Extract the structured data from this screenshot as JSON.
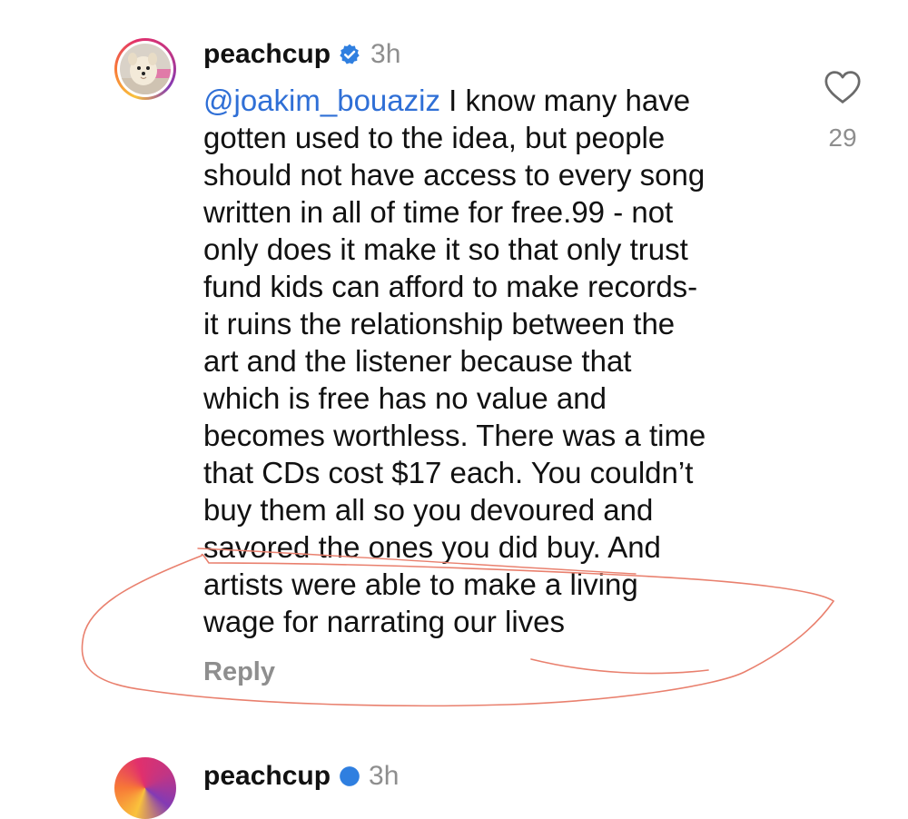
{
  "comment": {
    "username": "peachcup",
    "verified_icon": "verified-badge-icon",
    "time": "3h",
    "mention": "@joakim_bouaziz",
    "lines": [
      " I know many have",
      "gotten used to the idea, but people",
      "should not have access to every song",
      "written in all of time for free.99 - not",
      "only does it make it so that only trust",
      "fund kids can afford to make records-",
      "it ruins the relationship between the",
      "art and the listener because that",
      "which is free has no value and",
      "becomes worthless. There was a time",
      "that CDs cost $17 each. You couldn’t",
      "buy them all so you devoured and",
      "savored the ones you did buy. And",
      "artists were able to make a living",
      "wage for narrating our lives"
    ],
    "reply_label": "Reply",
    "like_count": "29",
    "like_icon": "heart-outline-icon"
  },
  "next_comment": {
    "username": "peachcup",
    "time": "3h"
  },
  "colors": {
    "mention": "#2f6fd6",
    "verified": "#2f7fe0",
    "annotation_stroke": "#e9806e",
    "secondary_text": "#8e8e8e"
  }
}
